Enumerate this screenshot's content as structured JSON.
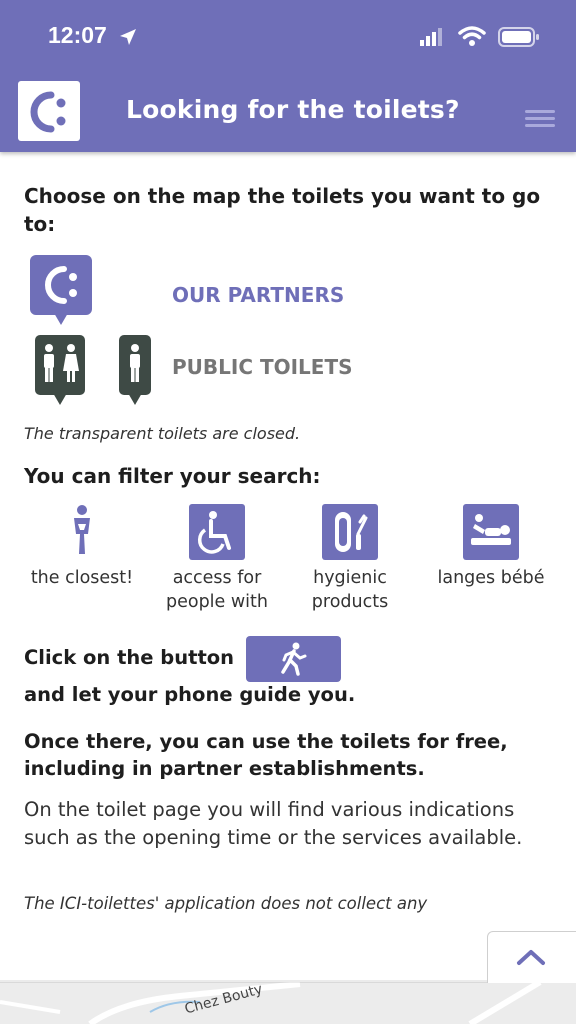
{
  "status_bar": {
    "time": "12:07"
  },
  "header": {
    "title": "Looking for the toilets?",
    "accent_color": "#6f6fb8",
    "logo_icon": "ici-logo-icon",
    "menu_icon": "hamburger-menu-icon"
  },
  "intro": {
    "choose_text": "Choose on the map the toilets you want to go to:",
    "partners_label": "OUR PARTNERS",
    "public_label": "PUBLIC TOILETS",
    "closed_note": "The transparent toilets are closed."
  },
  "filters": {
    "heading": "You can filter your search:",
    "items": [
      {
        "label": "the closest!",
        "icon": "person-standing-icon"
      },
      {
        "label": "access for people with",
        "icon": "wheelchair-icon"
      },
      {
        "label": "hygienic products",
        "icon": "sanitary-pad-icon"
      },
      {
        "label": "langes bébé",
        "icon": "baby-changing-icon"
      }
    ]
  },
  "guide": {
    "click_text": "Click on the button",
    "button_icon": "walking-person-icon",
    "let_text": "and let your phone guide you.",
    "once_text": "Once there, you can use the toilets for free, including in partner establishments.",
    "info_text": "On the toilet page you will find various indications such as the opening time or the services available.",
    "privacy_text": "The ICI-toilettes' application does not collect any"
  },
  "map": {
    "place_label": "Chez Bouty"
  },
  "scroll_top": {
    "icon": "chevron-up-icon"
  }
}
